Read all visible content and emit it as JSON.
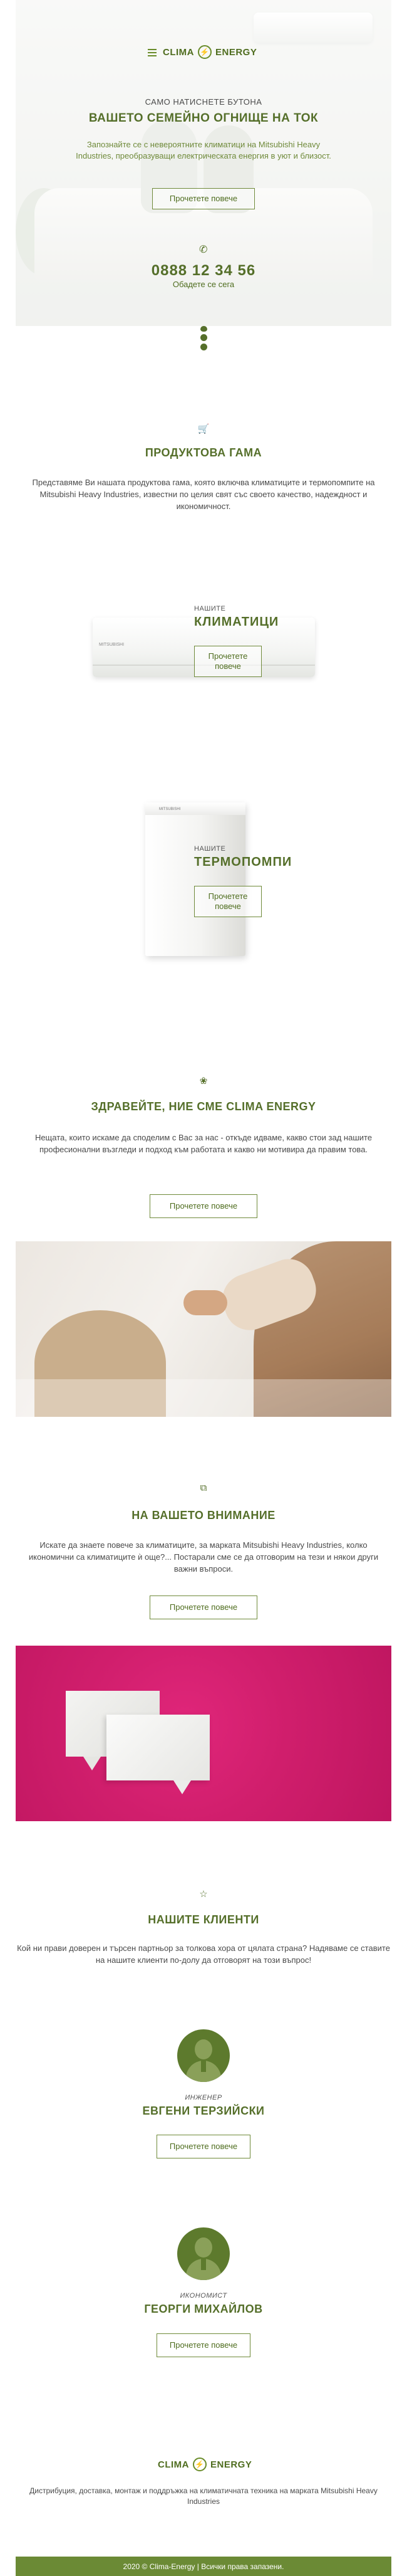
{
  "brand": {
    "name": "CLIMA",
    "suffix": "ENERGY"
  },
  "hero": {
    "kicker": "САМО НАТИСНЕТЕ БУТОНА",
    "title": "ВАШЕТО СЕМЕЙНО ОГНИЩЕ НА ТОК",
    "subtitle": "Запознайте се с невероятните климатици на Mitsubishi Heavy Industries, преобразуващи електрическата енергия в уют и близост.",
    "button": "Прочетете повече",
    "phone": "0888 12 34 56",
    "call": "Обадете се сега"
  },
  "products": {
    "icon": "cart-icon",
    "title": "ПРОДУКТОВА ГАМА",
    "text": "Представяме Ви нашата продуктова гама, която включва климатиците и термопомпите на Mitsubishi Heavy Industries, известни по целия свят със своето качество, надеждност и икономичност.",
    "items": [
      {
        "kicker": "НАШИТЕ",
        "title": "КЛИМАТИЦИ",
        "button": "Прочетете повече"
      },
      {
        "kicker": "НАШИТЕ",
        "title": "ТЕРМОПОМПИ",
        "button": "Прочетете повече"
      }
    ]
  },
  "about": {
    "icon": "lotus-icon",
    "title": "ЗДРАВЕЙТЕ, НИЕ СМЕ CLIMA ENERGY",
    "text": "Нещата, които искаме да споделим с Вас за нас - откъде идваме, какво стои зад нашите професионални възгледи и подход към работата и какво ни мотивира да правим това.",
    "button": "Прочетете повече"
  },
  "attention": {
    "icon": "copy-icon",
    "title": "НА ВАШЕТО ВНИМАНИЕ",
    "text": "Искате да знаете повече за климатиците, за марката Mitsubishi Heavy Industries, колко икономични са климатиците ѝ още?... Постарали сме се да отговорим на тези и някои други важни въпроси.",
    "button": "Прочетете повече"
  },
  "clients": {
    "icon": "star-icon",
    "title": "НАШИТЕ КЛИЕНТИ",
    "text": "Кой ни прави доверен и търсен партньор за толкова хора от цялата страна? Надяваме се ставите на нашите клиенти по-долу да отговорят на този въпрос!",
    "people": [
      {
        "role": "ИНЖЕНЕР",
        "name": "ЕВГЕНИ ТЕРЗИЙСКИ",
        "button": "Прочетете повече"
      },
      {
        "role": "ИКОНОМИСТ",
        "name": "ГЕОРГИ МИХАЙЛОВ",
        "button": "Прочетете повече"
      }
    ]
  },
  "footer": {
    "text": "Дистрибуция, доставка, монтаж и поддръжка на климатичната техника на марката Mitsubishi Heavy Industries",
    "copyright": "2020 © Clima-Energy | Всички права запазени."
  },
  "colors": {
    "accent": "#556f2a",
    "footer_bg": "#6b8a35",
    "pink": "#d01e6c"
  }
}
